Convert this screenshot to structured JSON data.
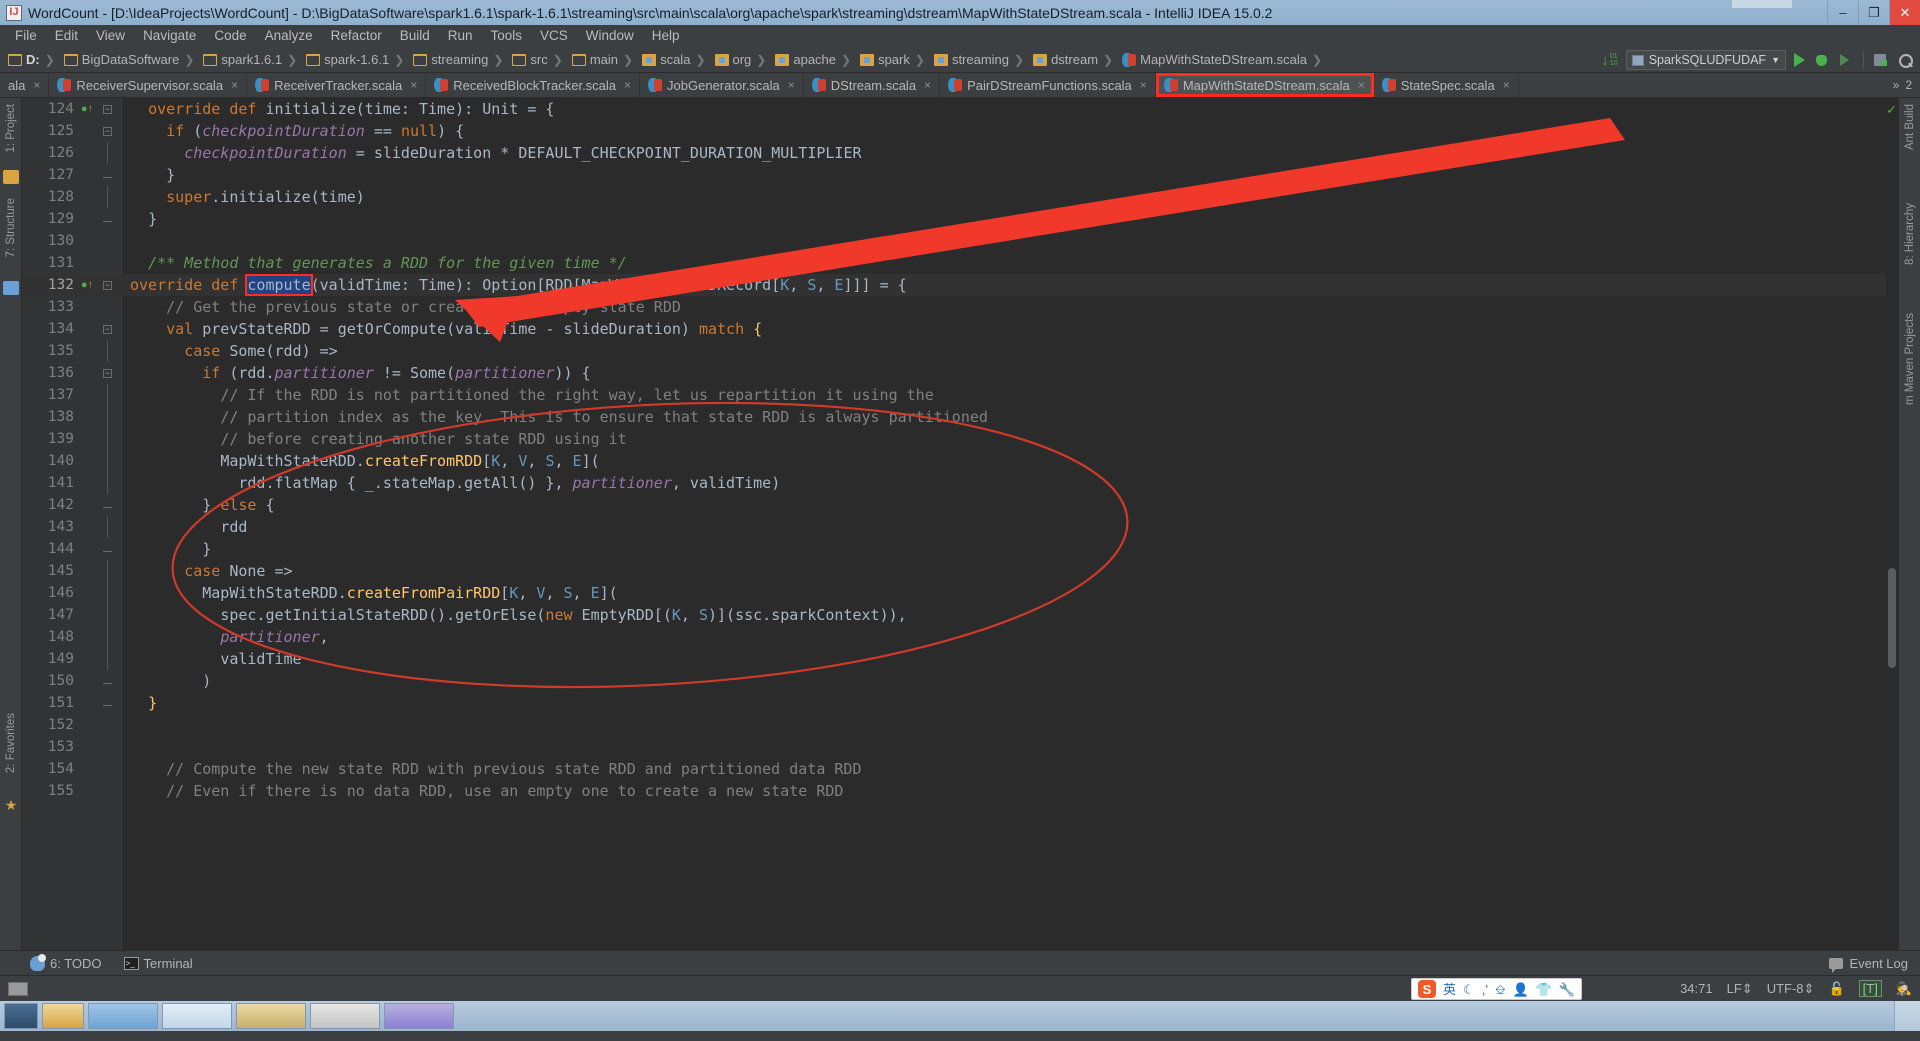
{
  "window": {
    "title": "WordCount - [D:\\IdeaProjects\\WordCount] - D:\\BigDataSoftware\\spark1.6.1\\spark-1.6.1\\streaming\\src\\main\\scala\\org\\apache\\spark\\streaming\\dstream\\MapWithStateDStream.scala - IntelliJ IDEA 15.0.2",
    "app_icon": "intellij-idea-icon",
    "minimize": "–",
    "maximize": "❐",
    "close": "✕"
  },
  "menu": {
    "items": [
      "File",
      "Edit",
      "View",
      "Navigate",
      "Code",
      "Analyze",
      "Refactor",
      "Build",
      "Run",
      "Tools",
      "VCS",
      "Window",
      "Help"
    ]
  },
  "navbar": {
    "crumbs": [
      {
        "label": "D:",
        "icon": "folder-icon",
        "bold": true
      },
      {
        "label": "BigDataSoftware",
        "icon": "folder-icon",
        "bold": false
      },
      {
        "label": "spark1.6.1",
        "icon": "folder-icon",
        "bold": false
      },
      {
        "label": "spark-1.6.1",
        "icon": "folder-icon",
        "bold": false
      },
      {
        "label": "streaming",
        "icon": "folder-icon",
        "bold": false
      },
      {
        "label": "src",
        "icon": "folder-icon",
        "bold": false
      },
      {
        "label": "main",
        "icon": "folder-icon",
        "bold": false
      },
      {
        "label": "scala",
        "icon": "package-icon",
        "bold": false
      },
      {
        "label": "org",
        "icon": "package-icon",
        "bold": false
      },
      {
        "label": "apache",
        "icon": "package-icon",
        "bold": false
      },
      {
        "label": "spark",
        "icon": "package-icon",
        "bold": false
      },
      {
        "label": "streaming",
        "icon": "package-icon",
        "bold": false
      },
      {
        "label": "dstream",
        "icon": "package-icon",
        "bold": false
      },
      {
        "label": "MapWithStateDStream.scala",
        "icon": "scala-file-icon",
        "bold": false
      }
    ],
    "run_config": "SparkSQLUDFUDAF",
    "run_config_caret": "▼",
    "icons": [
      "download-updates-icon",
      "run-icon",
      "debug-icon",
      "run-with-coverage-icon",
      "database-icon",
      "search-everywhere-icon"
    ]
  },
  "tabs": {
    "items": [
      {
        "label": "ala",
        "truncated": true,
        "active": false,
        "highlighted": false
      },
      {
        "label": "ReceiverSupervisor.scala",
        "truncated": false,
        "active": false,
        "highlighted": false
      },
      {
        "label": "ReceiverTracker.scala",
        "truncated": false,
        "active": false,
        "highlighted": false
      },
      {
        "label": "ReceivedBlockTracker.scala",
        "truncated": false,
        "active": false,
        "highlighted": false
      },
      {
        "label": "JobGenerator.scala",
        "truncated": false,
        "active": false,
        "highlighted": false
      },
      {
        "label": "DStream.scala",
        "truncated": false,
        "active": false,
        "highlighted": false
      },
      {
        "label": "PairDStreamFunctions.scala",
        "truncated": false,
        "active": false,
        "highlighted": false
      },
      {
        "label": "MapWithStateDStream.scala",
        "truncated": false,
        "active": true,
        "highlighted": true
      },
      {
        "label": "StateSpec.scala",
        "truncated": false,
        "active": false,
        "highlighted": false
      }
    ],
    "close_glyph": "×",
    "overflow_label": "»",
    "overflow_count": "2"
  },
  "left_tool_strip": {
    "items": [
      "1: Project",
      "7: Structure",
      "2: Favorites"
    ]
  },
  "right_tool_strip": {
    "items": [
      "Ant Build",
      "8: Hierarchy",
      "m Maven Projects"
    ]
  },
  "editor": {
    "first_line": 124,
    "current_line": 132,
    "lines": [
      {
        "n": 124,
        "fold": "start",
        "mark": "override-method-icon",
        "tokens": [
          {
            "t": "override",
            "c": "kw"
          },
          {
            "t": " ",
            "c": "plain"
          },
          {
            "t": "def",
            "c": "kw"
          },
          {
            "t": " ",
            "c": "plain"
          },
          {
            "t": "initialize",
            "c": "plain"
          },
          {
            "t": "(time: ",
            "c": "plain"
          },
          {
            "t": "Time",
            "c": "plain"
          },
          {
            "t": "): ",
            "c": "plain"
          },
          {
            "t": "Unit",
            "c": "plain"
          },
          {
            "t": " = {",
            "c": "plain"
          }
        ],
        "indent": 2
      },
      {
        "n": 125,
        "fold": "start",
        "tokens": [
          {
            "t": "if",
            "c": "kw"
          },
          {
            "t": " (",
            "c": "plain"
          },
          {
            "t": "checkpointDuration",
            "c": "fld"
          },
          {
            "t": " == ",
            "c": "plain"
          },
          {
            "t": "null",
            "c": "kw"
          },
          {
            "t": ") {",
            "c": "plain"
          }
        ],
        "indent": 4
      },
      {
        "n": 126,
        "fold": "line",
        "tokens": [
          {
            "t": "checkpointDuration",
            "c": "fld"
          },
          {
            "t": " = slideDuration * DEFAULT_CHECKPOINT_DURATION_MULTIPLIER",
            "c": "plain"
          }
        ],
        "indent": 6
      },
      {
        "n": 127,
        "fold": "end",
        "tokens": [
          {
            "t": "}",
            "c": "plain"
          }
        ],
        "indent": 4
      },
      {
        "n": 128,
        "fold": "line",
        "tokens": [
          {
            "t": "super",
            "c": "kw"
          },
          {
            "t": ".initialize(time)",
            "c": "plain"
          }
        ],
        "indent": 4
      },
      {
        "n": 129,
        "fold": "end",
        "tokens": [
          {
            "t": "}",
            "c": "plain"
          }
        ],
        "indent": 2
      },
      {
        "n": 130,
        "fold": "none",
        "tokens": [],
        "indent": 0
      },
      {
        "n": 131,
        "fold": "none",
        "tokens": [
          {
            "t": "/** Method that generates a RDD for the given time */",
            "c": "doc"
          }
        ],
        "indent": 2
      },
      {
        "n": 132,
        "fold": "start",
        "mark": "override-method-icon",
        "current": true,
        "tokens": [
          {
            "t": "override",
            "c": "kw"
          },
          {
            "t": " ",
            "c": "plain"
          },
          {
            "t": "def",
            "c": "kw"
          },
          {
            "t": " ",
            "c": "plain"
          },
          {
            "t": "compute",
            "c": "hl-box"
          },
          {
            "t": "(validTime: Time): Option[RDD[MapWithStateRDDRecord[",
            "c": "plain"
          },
          {
            "t": "K",
            "c": "typ"
          },
          {
            "t": ", ",
            "c": "plain"
          },
          {
            "t": "S",
            "c": "typ"
          },
          {
            "t": ", ",
            "c": "plain"
          },
          {
            "t": "E",
            "c": "typ"
          },
          {
            "t": "]]] = {",
            "c": "plain"
          }
        ],
        "indent": 0
      },
      {
        "n": 133,
        "fold": "none",
        "tokens": [
          {
            "t": "// Get the previous state or create a new empty state RDD",
            "c": "cmt"
          }
        ],
        "indent": 4
      },
      {
        "n": 134,
        "fold": "start",
        "tokens": [
          {
            "t": "val",
            "c": "kw"
          },
          {
            "t": " prevStateRDD = getOrCompute(validTime - slideDuration) ",
            "c": "plain"
          },
          {
            "t": "match",
            "c": "kw"
          },
          {
            "t": " ",
            "c": "plain"
          },
          {
            "t": "{",
            "c": "bracehl"
          }
        ],
        "indent": 4
      },
      {
        "n": 135,
        "fold": "line",
        "tokens": [
          {
            "t": "case",
            "c": "kw"
          },
          {
            "t": " ",
            "c": "plain"
          },
          {
            "t": "Some",
            "c": "plain"
          },
          {
            "t": "(rdd) =>",
            "c": "plain"
          }
        ],
        "indent": 6
      },
      {
        "n": 136,
        "fold": "start",
        "tokens": [
          {
            "t": "if",
            "c": "kw"
          },
          {
            "t": " (rdd.",
            "c": "plain"
          },
          {
            "t": "partitioner",
            "c": "fld"
          },
          {
            "t": " != ",
            "c": "plain"
          },
          {
            "t": "Some",
            "c": "plain"
          },
          {
            "t": "(",
            "c": "plain"
          },
          {
            "t": "partitioner",
            "c": "fld"
          },
          {
            "t": ")) {",
            "c": "plain"
          }
        ],
        "indent": 8
      },
      {
        "n": 137,
        "fold": "line",
        "tokens": [
          {
            "t": "// If the RDD is not partitioned the right way, let us repartition it using the",
            "c": "cmt"
          }
        ],
        "indent": 10
      },
      {
        "n": 138,
        "fold": "line",
        "tokens": [
          {
            "t": "// partition index as the key. This is to ensure that state RDD is always partitioned",
            "c": "cmt"
          }
        ],
        "indent": 10
      },
      {
        "n": 139,
        "fold": "line",
        "tokens": [
          {
            "t": "// before creating another state RDD using it",
            "c": "cmt"
          }
        ],
        "indent": 10
      },
      {
        "n": 140,
        "fold": "line",
        "tokens": [
          {
            "t": "MapWithStateRDD.",
            "c": "plain"
          },
          {
            "t": "createFromRDD",
            "c": "fn"
          },
          {
            "t": "[",
            "c": "plain"
          },
          {
            "t": "K",
            "c": "typ"
          },
          {
            "t": ", ",
            "c": "plain"
          },
          {
            "t": "V",
            "c": "typ"
          },
          {
            "t": ", ",
            "c": "plain"
          },
          {
            "t": "S",
            "c": "typ"
          },
          {
            "t": ", ",
            "c": "plain"
          },
          {
            "t": "E",
            "c": "typ"
          },
          {
            "t": "](",
            "c": "plain"
          }
        ],
        "indent": 10
      },
      {
        "n": 141,
        "fold": "line",
        "tokens": [
          {
            "t": "rdd.flatMap { _.stateMap.getAll() }, ",
            "c": "plain"
          },
          {
            "t": "partitioner",
            "c": "fld"
          },
          {
            "t": ", validTime)",
            "c": "plain"
          }
        ],
        "indent": 12
      },
      {
        "n": 142,
        "fold": "end",
        "tokens": [
          {
            "t": "} ",
            "c": "plain"
          },
          {
            "t": "else",
            "c": "kw"
          },
          {
            "t": " {",
            "c": "plain"
          }
        ],
        "indent": 8
      },
      {
        "n": 143,
        "fold": "line",
        "tokens": [
          {
            "t": "rdd",
            "c": "plain"
          }
        ],
        "indent": 10
      },
      {
        "n": 144,
        "fold": "end",
        "tokens": [
          {
            "t": "}",
            "c": "plain"
          }
        ],
        "indent": 8
      },
      {
        "n": 145,
        "fold": "line",
        "tokens": [
          {
            "t": "case",
            "c": "kw"
          },
          {
            "t": " ",
            "c": "plain"
          },
          {
            "t": "None",
            "c": "plain"
          },
          {
            "t": " =>",
            "c": "plain"
          }
        ],
        "indent": 6
      },
      {
        "n": 146,
        "fold": "line",
        "tokens": [
          {
            "t": "MapWithStateRDD.",
            "c": "plain"
          },
          {
            "t": "createFromPairRDD",
            "c": "fn"
          },
          {
            "t": "[",
            "c": "plain"
          },
          {
            "t": "K",
            "c": "typ"
          },
          {
            "t": ", ",
            "c": "plain"
          },
          {
            "t": "V",
            "c": "typ"
          },
          {
            "t": ", ",
            "c": "plain"
          },
          {
            "t": "S",
            "c": "typ"
          },
          {
            "t": ", ",
            "c": "plain"
          },
          {
            "t": "E",
            "c": "typ"
          },
          {
            "t": "](",
            "c": "plain"
          }
        ],
        "indent": 8
      },
      {
        "n": 147,
        "fold": "line",
        "tokens": [
          {
            "t": "spec.getInitialStateRDD().getOrElse(",
            "c": "plain"
          },
          {
            "t": "new",
            "c": "kw"
          },
          {
            "t": " EmptyRDD[(",
            "c": "plain"
          },
          {
            "t": "K",
            "c": "typ"
          },
          {
            "t": ", ",
            "c": "plain"
          },
          {
            "t": "S",
            "c": "typ"
          },
          {
            "t": ")](ssc.sparkContext)),",
            "c": "plain"
          }
        ],
        "indent": 10
      },
      {
        "n": 148,
        "fold": "line",
        "tokens": [
          {
            "t": "partitioner",
            "c": "fld"
          },
          {
            "t": ",",
            "c": "plain"
          }
        ],
        "indent": 10
      },
      {
        "n": 149,
        "fold": "line",
        "tokens": [
          {
            "t": "validTime",
            "c": "plain"
          }
        ],
        "indent": 10
      },
      {
        "n": 150,
        "fold": "end",
        "tokens": [
          {
            "t": ")",
            "c": "plain"
          }
        ],
        "indent": 8
      },
      {
        "n": 151,
        "fold": "end",
        "tokens": [
          {
            "t": "}",
            "c": "bracehl"
          }
        ],
        "indent": 2
      },
      {
        "n": 152,
        "fold": "none",
        "tokens": [],
        "indent": 0
      },
      {
        "n": 153,
        "fold": "none",
        "tokens": [],
        "indent": 0
      },
      {
        "n": 154,
        "fold": "none",
        "tokens": [
          {
            "t": "// Compute the new state RDD with previous state RDD and partitioned data RDD",
            "c": "cmt"
          }
        ],
        "indent": 4
      },
      {
        "n": 155,
        "fold": "none",
        "tokens": [
          {
            "t": "// Even if there is no data RDD, use an empty one to create a new state RDD",
            "c": "cmt"
          }
        ],
        "indent": 4
      }
    ]
  },
  "annotations": {
    "arrow_color": "#f0392b",
    "ellipse_color": "#d03a2b",
    "tab_box_color": "#ff2d20",
    "compute_box_color": "#ff2d20"
  },
  "bottom_bar": {
    "todo": "6: TODO",
    "todo_underline": "6",
    "terminal": "Terminal",
    "event_log": "Event Log"
  },
  "status_bar": {
    "caret_position": "34:71",
    "line_separator": "LF",
    "encoding": "UTF-8",
    "lock_icon": "unlocked-icon",
    "tt_badge": "[T]",
    "inspector_icon": "inspector-icon",
    "separator_caret": "⇕"
  },
  "ime_toolbar": {
    "logo": "S",
    "mode": "英",
    "items": [
      "moon-icon",
      "comma-icon",
      "keyboard-icon",
      "user-icon",
      "skin-icon",
      "wrench-icon"
    ]
  },
  "taskbar": {
    "items": [
      "start-button",
      "explorer-button",
      "browser-window",
      "folder-window",
      "ide-window",
      "chrome-window",
      "media-window"
    ]
  }
}
